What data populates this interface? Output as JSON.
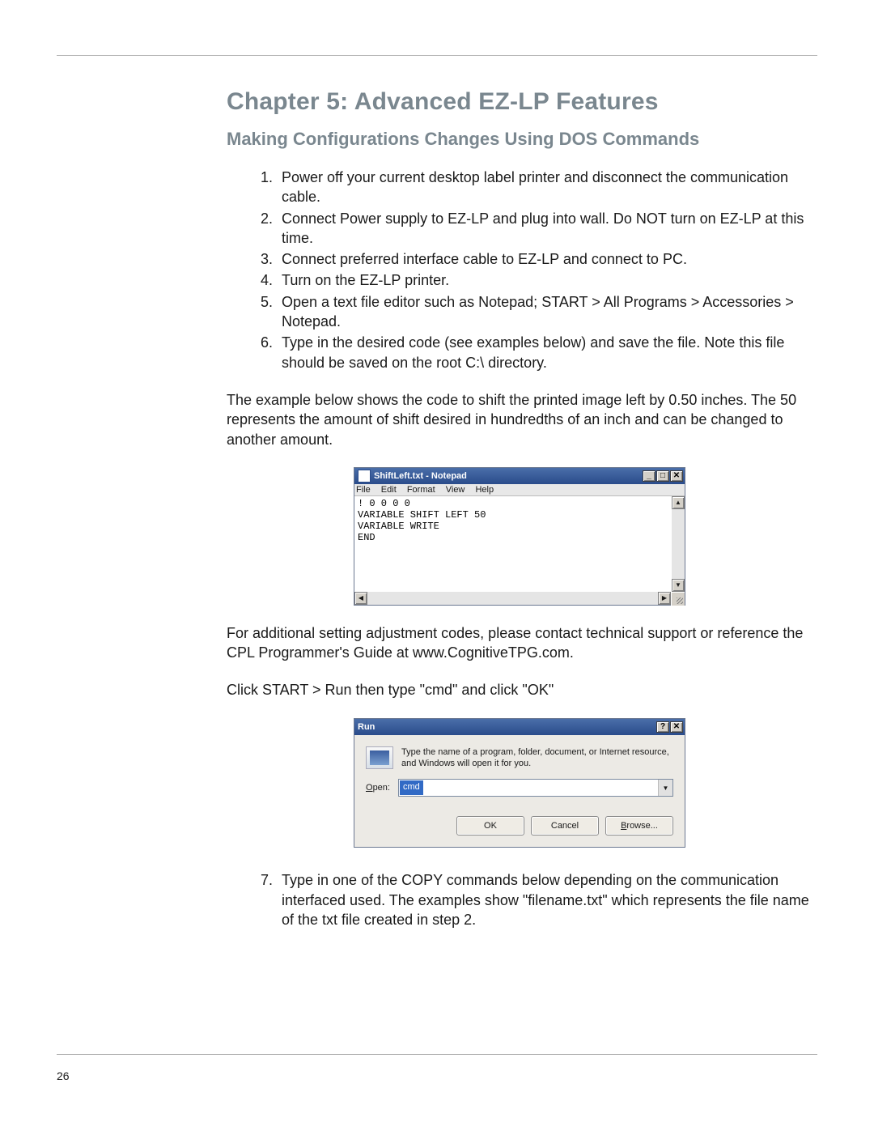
{
  "page_number": "26",
  "chapter_title": "Chapter 5: Advanced EZ-LP Features",
  "section_title": "Making Configurations Changes Using DOS Commands",
  "steps_first": [
    "Power off your current desktop label printer and disconnect the communication cable.",
    "Connect Power supply to EZ-LP and plug into wall. Do NOT turn on EZ-LP at this time.",
    "Connect preferred interface cable to EZ-LP and connect to PC.",
    "Turn on the EZ-LP printer.",
    "Open a text file editor such as Notepad; START > All Programs > Accessories > Notepad.",
    "Type in the desired code (see examples below) and save the file. Note this file should be saved on the root C:\\ directory."
  ],
  "para1": "The example below shows the code to shift the printed image left by 0.50 inches. The 50 represents the amount of shift desired in hundredths of an inch and can be changed to another amount.",
  "notepad": {
    "title": "ShiftLeft.txt - Notepad",
    "menu": [
      "File",
      "Edit",
      "Format",
      "View",
      "Help"
    ],
    "content": "! 0 0 0 0\nVARIABLE SHIFT LEFT 50\nVARIABLE WRITE\nEND",
    "sys": {
      "min": "_",
      "max": "□",
      "close": "✕"
    }
  },
  "para2": "For additional setting adjustment codes, please contact technical support or reference the CPL Programmer's Guide at www.CognitiveTPG.com.",
  "para3": "Click START > Run then type \"cmd\" and click \"OK\"",
  "run": {
    "title": "Run",
    "help_text": "Type the name of a program, folder, document, or Internet resource, and Windows will open it for you.",
    "open_label": "Open:",
    "value": "cmd",
    "buttons": {
      "ok": "OK",
      "cancel": "Cancel",
      "browse": "Browse..."
    },
    "sys": {
      "help": "?",
      "close": "✕"
    }
  },
  "steps_second": [
    "Type in one of the COPY commands below depending on the communication interfaced used. The examples show \"filename.txt\" which represents the file name of the txt file created in step 2."
  ]
}
